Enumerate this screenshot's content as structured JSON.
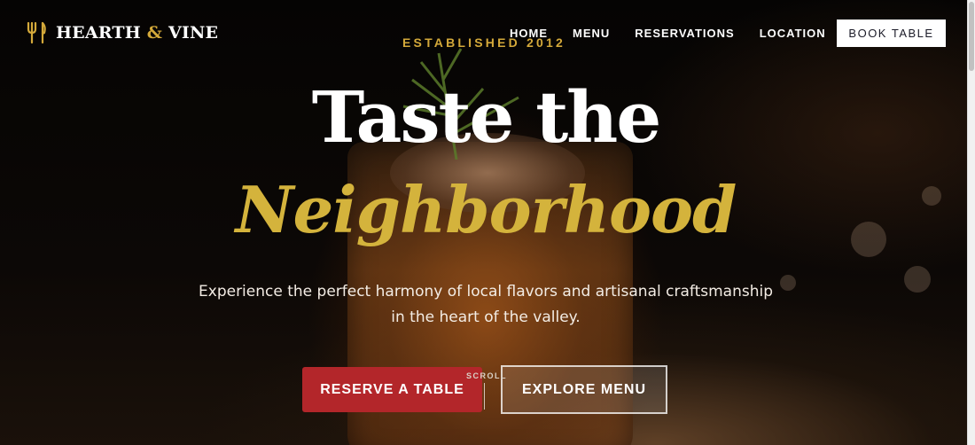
{
  "brand": {
    "name_part1": "HEARTH",
    "ampersand": "&",
    "name_part2": "VINE",
    "accent_color": "#d4a93a"
  },
  "nav": {
    "items": [
      {
        "label": "HOME"
      },
      {
        "label": "MENU"
      },
      {
        "label": "RESERVATIONS"
      },
      {
        "label": "LOCATION"
      }
    ],
    "cta_label": "BOOK TABLE"
  },
  "hero": {
    "eyebrow": "ESTABLISHED 2012",
    "headline_line1": "Taste the",
    "headline_line2": "Neighborhood",
    "subtitle_line1": "Experience the perfect harmony of local flavors and artisanal craftsmanship",
    "subtitle_line2": "in the heart of the valley.",
    "primary_button": "RESERVE A TABLE",
    "secondary_button": "EXPLORE MENU",
    "scroll_label": "SCROLL",
    "primary_color": "#b3262a",
    "headline_accent_color": "#d4b33c"
  },
  "icons": {
    "logo": "fork-and-spoon-icon"
  }
}
